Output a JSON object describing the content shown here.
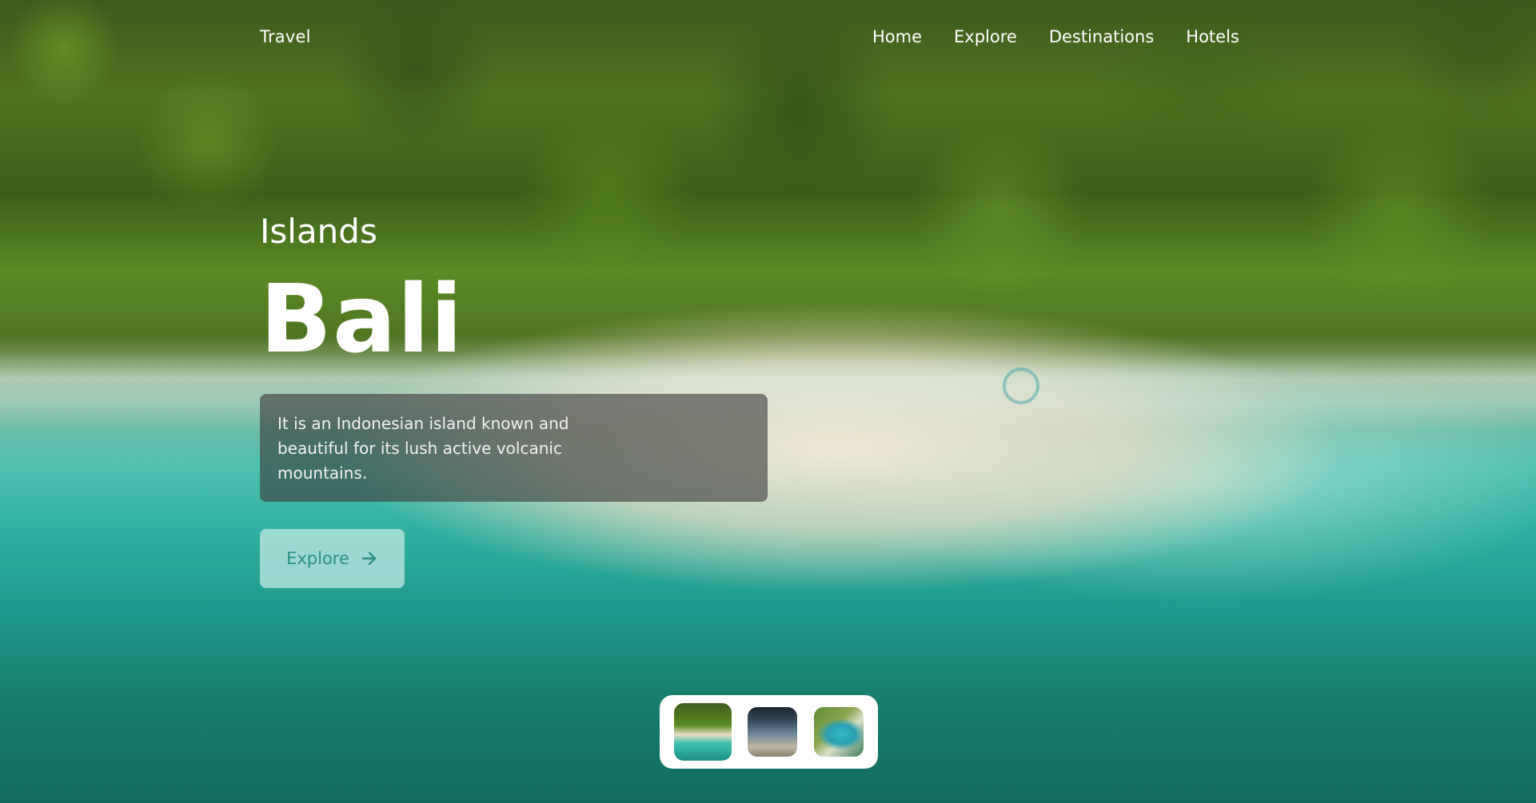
{
  "nav": {
    "brand": "Travel",
    "links": [
      "Home",
      "Explore",
      "Destinations",
      "Hotels"
    ]
  },
  "hero": {
    "category": "Islands",
    "title": "Bali",
    "description": "It is an Indonesian island known and beautiful for its lush active volcanic mountains.",
    "cta_label": "Explore",
    "cta_icon": "arrow-right-icon"
  },
  "colors": {
    "accent": "#2e8f86",
    "text": "#ffffff"
  },
  "thumbnails": {
    "count_visible": 3,
    "active_index": 0
  }
}
